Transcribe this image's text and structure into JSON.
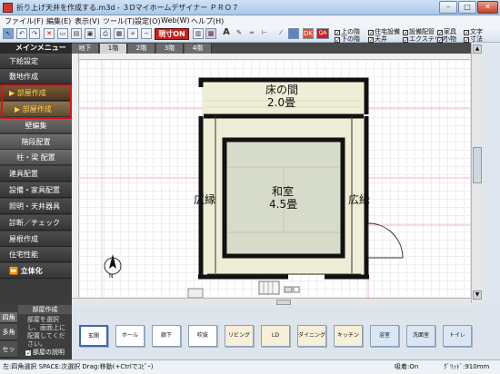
{
  "window": {
    "title": "折り上げ天井を作成する.m3d - ３Dマイホームデザイナー ＰＲＯ７",
    "minimize": "–",
    "maximize": "□",
    "close": "✕"
  },
  "menu": [
    "ファイル(F)",
    "編集(E)",
    "表示(V)",
    "ツール(T)",
    "設定(O)",
    "Web(W)",
    "ヘルプ(H)"
  ],
  "toolbar": {
    "genpin_label": "現寸ON",
    "checkboxes": [
      "上の階",
      "下の階",
      "住宅設備",
      "天井",
      "設備配管",
      "エクステリア",
      "家具",
      "小物",
      "文字",
      "寸法"
    ]
  },
  "sidebar": {
    "header": "メインメニュー",
    "items": [
      "下絵設定",
      "敷地作成",
      "部屋作成"
    ],
    "subitems": [
      "部屋作成",
      "壁編集",
      "階段配置",
      "柱・梁 配置"
    ],
    "items_after": [
      "建具配置",
      "設備・家具配置",
      "照明・天井器具",
      "診断／チェック",
      "屋根作成",
      "住宅性能",
      "立体化"
    ]
  },
  "floor_tabs": [
    "地下",
    "1階",
    "2階",
    "3階",
    "4階"
  ],
  "active_floor": "1階",
  "plan": {
    "room_top_name": "床の間",
    "room_top_size": "2.0畳",
    "room_main_name": "和室",
    "room_main_size": "4.5畳",
    "left_label": "広縁",
    "right_label": "広縁"
  },
  "parts_panel": {
    "header": "部屋作成",
    "mode_buttons": [
      "四角",
      "多角",
      "セット"
    ],
    "description": "部屋を選択し、画面上に配置してください。",
    "explain_label": "部屋の説明",
    "parts": [
      "玄関",
      "ホール",
      "廊下",
      "吹抜",
      "リビング",
      "LD",
      "ダイニング",
      "キッチン",
      "浴室",
      "洗面室",
      "トイレ"
    ]
  },
  "status": {
    "text": "左:四角選択 SPACE:次選択 Drag:移動(+Ctrlでｺﾋﾟｰ)",
    "snap": "吸着:On",
    "grid": "ｸﾞﾘｯﾄﾞ:910mm"
  },
  "colors": {
    "accent_red": "#c8201a",
    "tatami": "#eeeed6",
    "wall": "#111111",
    "highlight_box": "#e01010"
  }
}
